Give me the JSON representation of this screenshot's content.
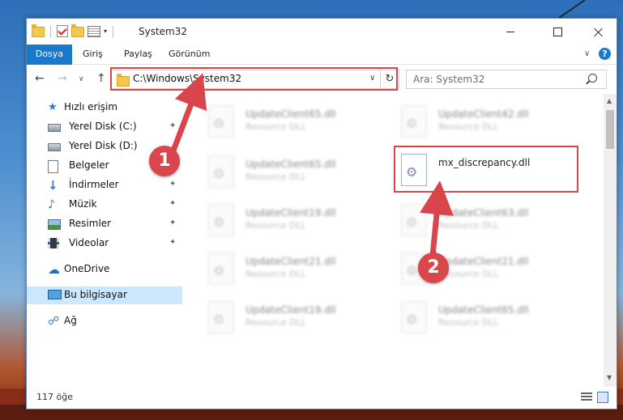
{
  "window": {
    "title": "System32"
  },
  "ribbon": {
    "tabs": [
      {
        "label": "Dosya"
      },
      {
        "label": "Giriş"
      },
      {
        "label": "Paylaş"
      },
      {
        "label": "Görünüm"
      }
    ],
    "help_label": "?"
  },
  "navigation": {
    "address": "C:\\Windows\\System32",
    "search_placeholder": "Ara: System32"
  },
  "sidebar": {
    "items": [
      {
        "label": "Hızlı erişim",
        "icon": "star-icon"
      },
      {
        "label": "Yerel Disk (C:)",
        "icon": "disk-icon"
      },
      {
        "label": "Yerel Disk (D:)",
        "icon": "disk-icon"
      },
      {
        "label": "Belgeler",
        "icon": "document-icon"
      },
      {
        "label": "İndirmeler",
        "icon": "download-icon"
      },
      {
        "label": "Müzik",
        "icon": "music-icon"
      },
      {
        "label": "Resimler",
        "icon": "pictures-icon"
      },
      {
        "label": "Videolar",
        "icon": "videos-icon"
      },
      {
        "label": "OneDrive",
        "icon": "cloud-icon"
      },
      {
        "label": "Bu bilgisayar",
        "icon": "computer-icon"
      },
      {
        "label": "Ağ",
        "icon": "network-icon"
      }
    ]
  },
  "files": [
    {
      "name": "UpdateClient65.dll",
      "type": "Resource DLL"
    },
    {
      "name": "UpdateClient42.dll",
      "type": "Resource DLL"
    },
    {
      "name": "UpdateClient65.dll",
      "type": "Resource DLL"
    },
    {
      "name": "mx_discrepancy.dll",
      "type": ""
    },
    {
      "name": "UpdateClient19.dll",
      "type": "Resource DLL"
    },
    {
      "name": "UpdateClient63.dll",
      "type": "Resource DLL"
    },
    {
      "name": "UpdateClient21.dll",
      "type": "Resource DLL"
    },
    {
      "name": "UpdateClient21.dll",
      "type": "Resource DLL"
    },
    {
      "name": "UpdateClient19.dll",
      "type": "Resource DLL"
    },
    {
      "name": "UpdateClient65.dll",
      "type": "Resource DLL"
    }
  ],
  "status": {
    "item_count": "117 öğe"
  },
  "annotations": {
    "step1": "1",
    "step2": "2",
    "color": "#d8454a"
  },
  "colors": {
    "accent": "#1979ca",
    "selected_bg": "#cce8ff"
  }
}
